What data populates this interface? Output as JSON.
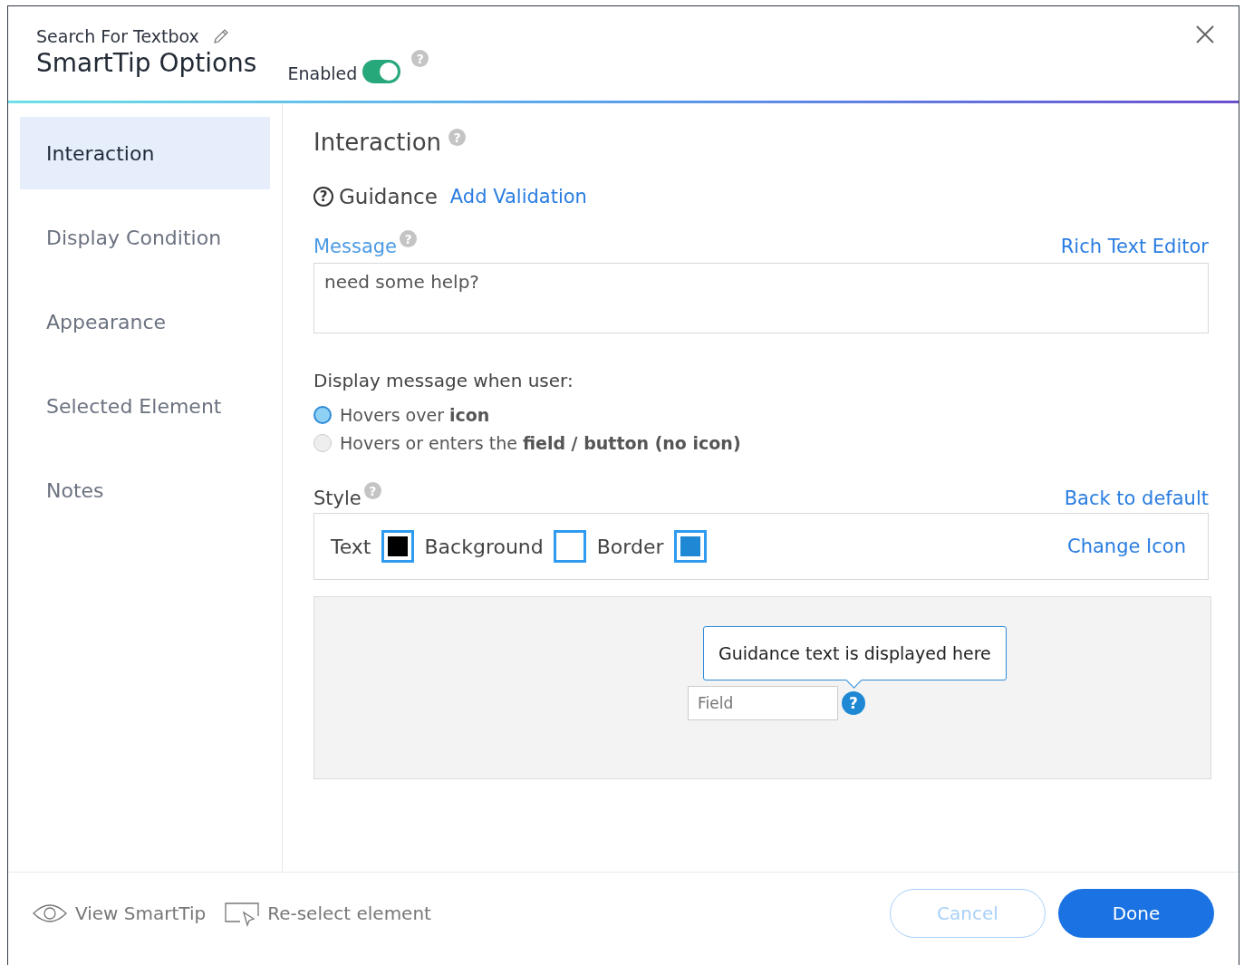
{
  "header": {
    "subtitle": "Search For Textbox",
    "title": "SmartTip Options",
    "enabled_label": "Enabled",
    "enabled": true
  },
  "sidebar": {
    "items": [
      {
        "label": "Interaction",
        "selected": true
      },
      {
        "label": "Display Condition",
        "selected": false
      },
      {
        "label": "Appearance",
        "selected": false
      },
      {
        "label": "Selected Element",
        "selected": false
      },
      {
        "label": "Notes",
        "selected": false
      }
    ]
  },
  "content": {
    "heading": "Interaction",
    "guidance_label": "Guidance",
    "add_validation": "Add Validation",
    "message_label": "Message",
    "rich_text_editor": "Rich Text Editor",
    "message_value": "need some help?",
    "display_label": "Display message when user:",
    "options": [
      {
        "label": "Hovers over **icon**",
        "selected": true
      },
      {
        "label": "Hovers or enters the **field / button (no icon)**",
        "selected": false
      }
    ],
    "style_label": "Style",
    "back_to_default": "Back to default",
    "swatches": [
      {
        "label": "Text",
        "color": "#000000"
      },
      {
        "label": "Background",
        "color": "#ffffff"
      },
      {
        "label": "Border",
        "color": "#1e88d4"
      }
    ],
    "change_icon": "Change Icon",
    "preview": {
      "tooltip": "Guidance text is displayed here",
      "field_placeholder": "Field",
      "icon": "?"
    }
  },
  "footer": {
    "view": "View SmartTip",
    "reselect": "Re-select element",
    "cancel": {
      "label": "Cancel",
      "disabled": true
    },
    "done": "Done"
  }
}
